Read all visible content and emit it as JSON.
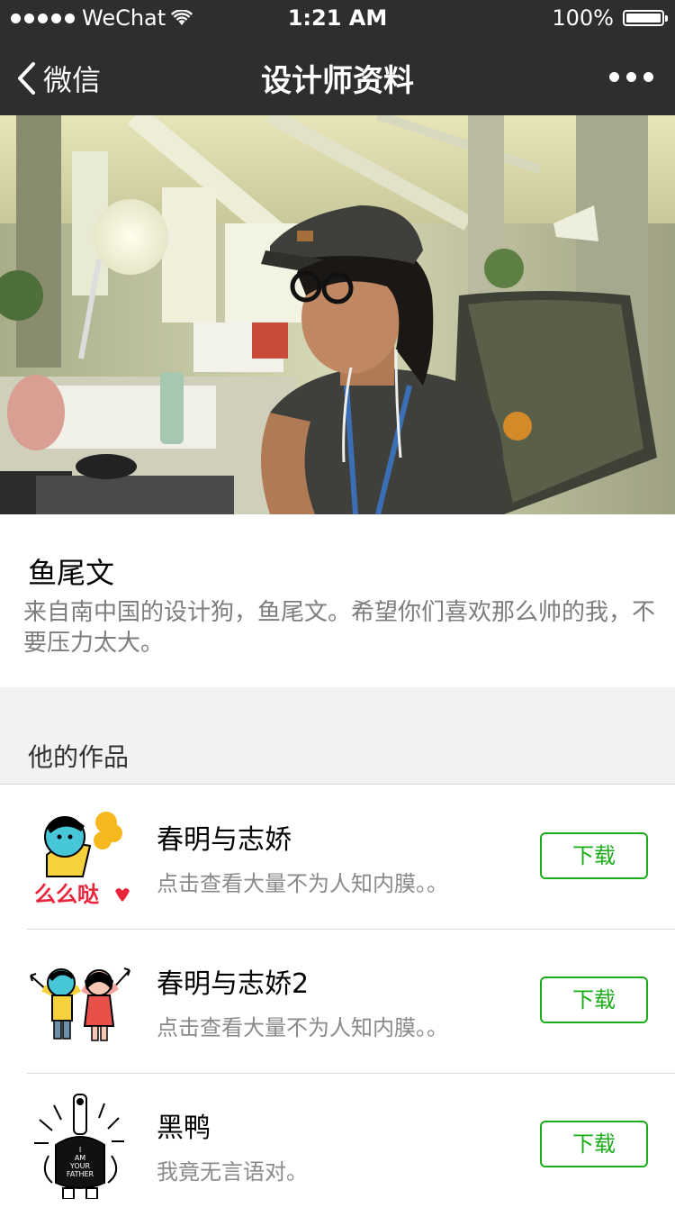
{
  "status_bar": {
    "carrier": "WeChat",
    "time": "1:21 AM",
    "battery": "100%"
  },
  "nav": {
    "back_label": "微信",
    "title": "设计师资料"
  },
  "profile": {
    "name": "鱼尾文",
    "bio": "来自南中国的设计狗，鱼尾文。希望你们喜欢那么帅的我，不要压力太大。"
  },
  "works_section": {
    "title": "他的作品",
    "items": [
      {
        "title": "春明与志娇",
        "desc": "点击查看大量不为人知内膜。。",
        "button": "下载",
        "thumb_text": "么么哒"
      },
      {
        "title": "春明与志娇2",
        "desc": "点击查看大量不为人知内膜。。",
        "button": "下载"
      },
      {
        "title": "黑鸭",
        "desc": "我竟无言语对。",
        "button": "下载",
        "thumb_text_lines": [
          "I",
          "AM",
          "YOUR",
          "FATHER"
        ]
      }
    ]
  },
  "colors": {
    "nav_bg": "#2e2e31",
    "accent_green": "#1aad19",
    "section_bg": "#f2f2f2",
    "secondary_text": "#7d7d7d"
  }
}
